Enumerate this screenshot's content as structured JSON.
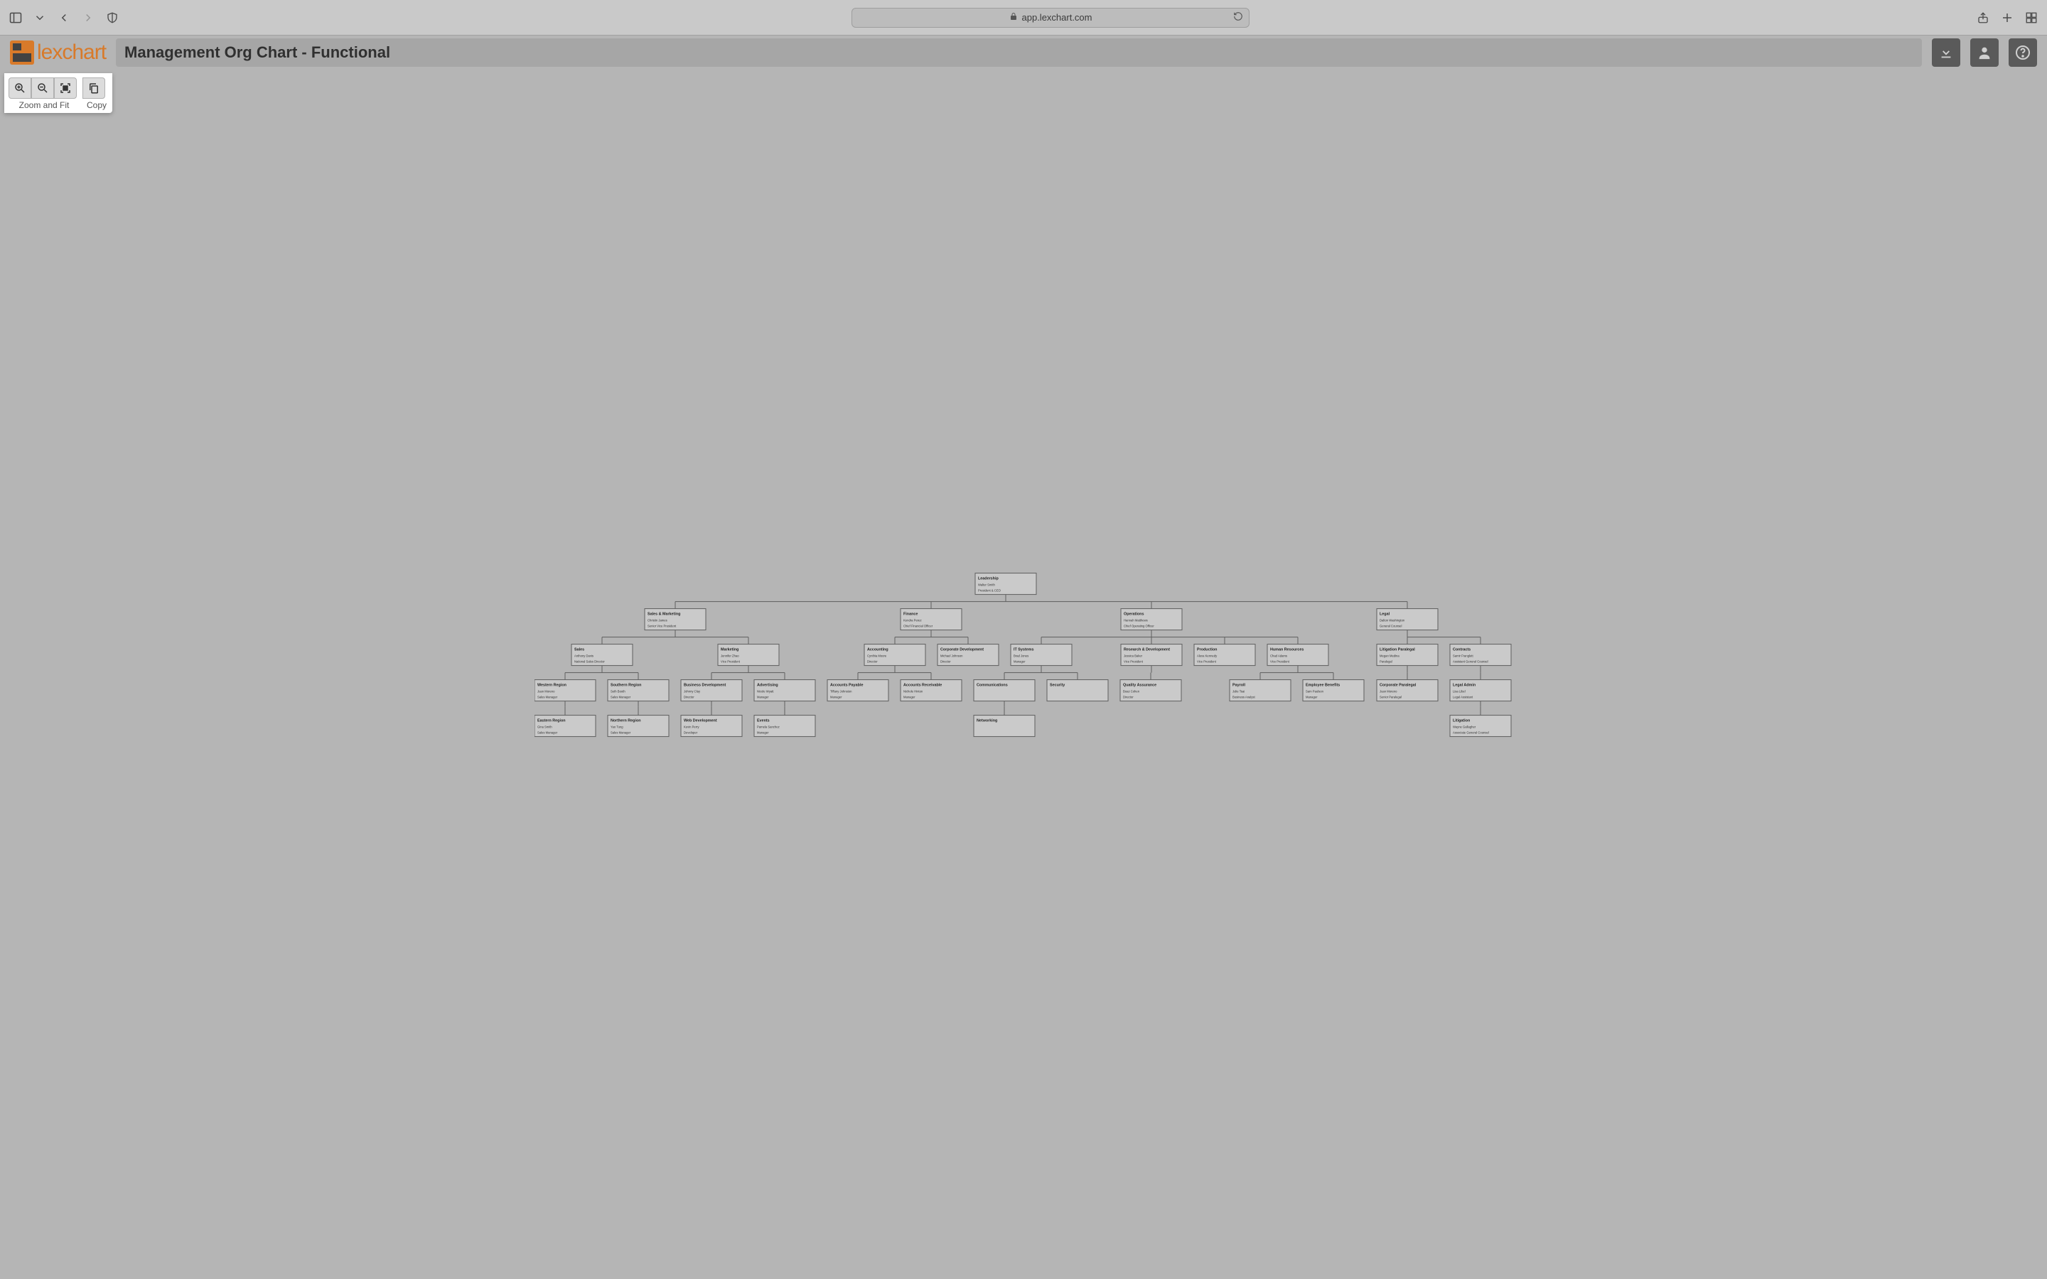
{
  "browser": {
    "url": "app.lexchart.com"
  },
  "app": {
    "brand": "lexchart",
    "title": "Management Org Chart - Functional"
  },
  "toolbar": {
    "zoom_label": "Zoom and Fit",
    "copy_label": "Copy"
  },
  "org": {
    "root": {
      "dept": "Leadership",
      "name": "Walter Smith",
      "role": "President & CEO"
    },
    "l1": [
      {
        "dept": "Sales & Marketing",
        "name": "Christin James",
        "role": "Senior Vice President"
      },
      {
        "dept": "Finance",
        "name": "Kendra Perez",
        "role": "Chief Financial Officer"
      },
      {
        "dept": "Operations",
        "name": "Hannah Matthews",
        "role": "Chief Operating Officer"
      },
      {
        "dept": "Legal",
        "name": "Dalton Washington",
        "role": "General Counsel"
      }
    ],
    "l2": [
      {
        "dept": "Sales",
        "name": "Anthony Davis",
        "role": "National Sales Director"
      },
      {
        "dept": "Marketing",
        "name": "Jennifer Zhao",
        "role": "Vice President"
      },
      {
        "dept": "Accounting",
        "name": "Cynthia Moore",
        "role": "Director"
      },
      {
        "dept": "Corporate Development",
        "name": "Michael Johnson",
        "role": "Director"
      },
      {
        "dept": "IT Systems",
        "name": "Brad Jones",
        "role": "Manager"
      },
      {
        "dept": "Research & Development",
        "name": "Jessica Baker",
        "role": "Vice President"
      },
      {
        "dept": "Production",
        "name": "Alexa Kennedy",
        "role": "Vice President"
      },
      {
        "dept": "Human Resources",
        "name": "Chad Adams",
        "role": "Vice President"
      },
      {
        "dept": "Litigation Paralegal",
        "name": "Megan Medina",
        "role": "Paralegal"
      },
      {
        "dept": "Contracts",
        "name": "Samir Franglett",
        "role": "Assistant General Counsel"
      }
    ],
    "l3": [
      {
        "dept": "Western Region",
        "name": "Juan Moreno",
        "role": "Sales Manager"
      },
      {
        "dept": "Southern Region",
        "name": "Seth Booth",
        "role": "Sales Manager"
      },
      {
        "dept": "Business Development",
        "name": "Johnny Clay",
        "role": "Director"
      },
      {
        "dept": "Advertising",
        "name": "Nicole Wyatt",
        "role": "Manager"
      },
      {
        "dept": "Accounts Payable",
        "name": "Tiffany Johnston",
        "role": "Manager"
      },
      {
        "dept": "Accounts Receivable",
        "name": "Nichole Hinton",
        "role": "Manager"
      },
      {
        "dept": "Communications",
        "name": "",
        "role": ""
      },
      {
        "dept": "Security",
        "name": "",
        "role": ""
      },
      {
        "dept": "Quality Assurance",
        "name": "Boaz Cohen",
        "role": "Director"
      },
      {
        "dept": "Payroll",
        "name": "Julie Tsai",
        "role": "Business Analyst"
      },
      {
        "dept": "Employee Benefits",
        "name": "Sam Paulson",
        "role": "Manager"
      },
      {
        "dept": "Corporate Paralegal",
        "name": "Juan Moreno",
        "role": "Senior Paralegal"
      },
      {
        "dept": "Legal Admin",
        "name": "Lisa Libel",
        "role": "Legal Assistant"
      }
    ],
    "l4": [
      {
        "dept": "Eastern Region",
        "name": "Gina Smith",
        "role": "Sales Manager"
      },
      {
        "dept": "Northern Region",
        "name": "Yao Tung",
        "role": "Sales Manager"
      },
      {
        "dept": "Web Development",
        "name": "Kevin Perry",
        "role": "Developer"
      },
      {
        "dept": "Events",
        "name": "Pamela Sanchez",
        "role": "Manager"
      },
      {
        "dept": "Networking",
        "name": "",
        "role": ""
      },
      {
        "dept": "Litigation",
        "name": "Wayne Gallagher",
        "role": "Associate General Counsel"
      }
    ]
  }
}
